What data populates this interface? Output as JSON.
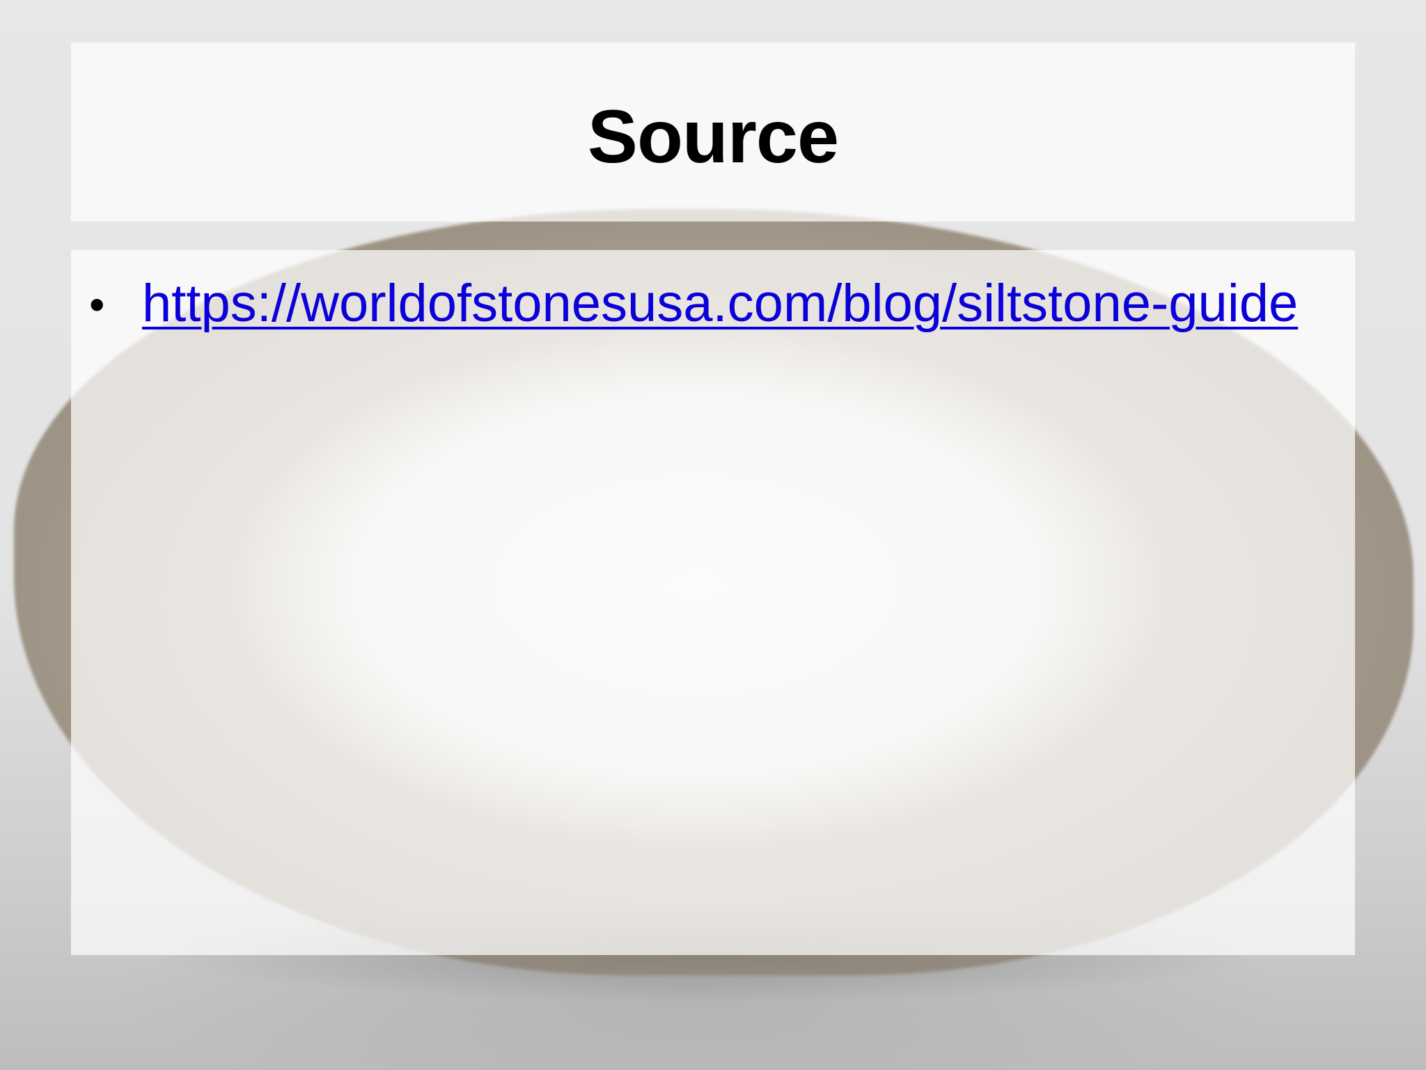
{
  "slide": {
    "title": "Source",
    "bullets": [
      {
        "type": "link",
        "text": "https://worldofstonesusa.com/blog/siltstone-guide"
      }
    ]
  },
  "colors": {
    "title": "#000000",
    "link": "#0b00d9",
    "panel": "#ffffff"
  },
  "icons": {
    "bullet": "bullet-icon"
  }
}
